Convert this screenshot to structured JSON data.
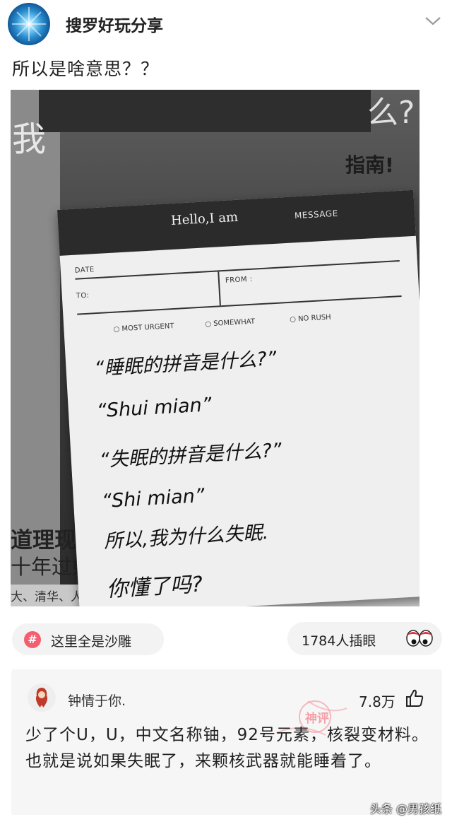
{
  "header": {
    "account_name": "搜罗好玩分享",
    "avatar_icon": "blue-starburst-avatar",
    "menu_icon": "chevron-down-icon"
  },
  "post": {
    "text": "所以是啥意思？？",
    "photo": {
      "note": {
        "header_title": "Hello,I am",
        "header_tag": "MESSAGE",
        "date_label": "DATE",
        "to_label": "TO:",
        "from_label": "FROM :",
        "options": [
          "MOST URGENT",
          "SOMEWHAT",
          "NO RUSH"
        ],
        "handwriting": [
          "“睡眠的拼音是什么?”",
          "“Shui mian”",
          "“失眠的拼音是什么?”",
          "“Shi mian”",
          "所以,我为什么失眠.",
          "你懂了吗?"
        ]
      },
      "background_text": {
        "right_title": "指南!",
        "right_big": "么?",
        "left_big": "我",
        "bottom_line1": "道理现",
        "bottom_line2": "十年过好了，你就赢了!",
        "bottom_line3": "大、清华、人大等高校师生欢迎的一本书!"
      }
    }
  },
  "tag": {
    "icon": "hashtag-icon",
    "label": "这里全是沙雕"
  },
  "reaction": {
    "label": "1784人插眼",
    "icon": "eyes-emoji-icon"
  },
  "comment": {
    "author": "钟情于你.",
    "likes": "7.8万",
    "like_icon": "thumbs-up-icon",
    "stamp_text": "神评",
    "body": "少了个U，U，中文名称铀，92号元素，核裂变材料。也就是说如果失眠了，来颗核武器就能睡着了。"
  },
  "watermark": "头条 @男孩纸",
  "colors": {
    "tag_icon": "#f45e70",
    "stamp": "#f4a0a8",
    "pill_bg": "#f3f3f3",
    "comment_bg": "#f6f6f6"
  }
}
